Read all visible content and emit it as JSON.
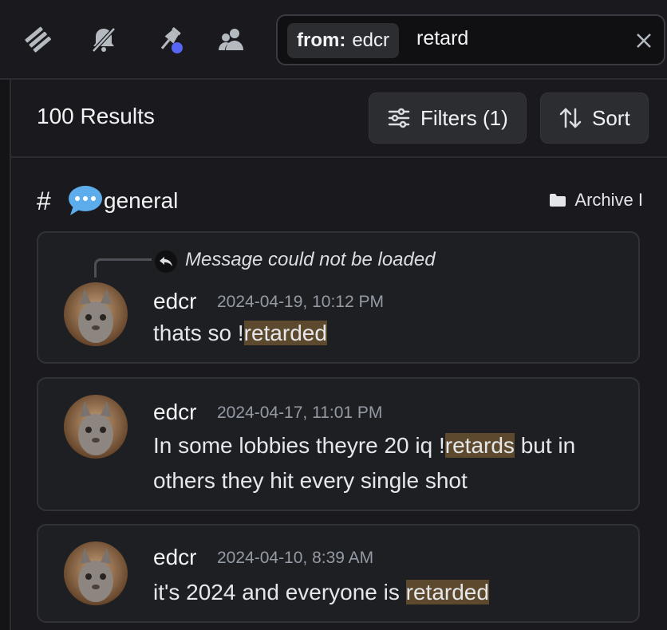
{
  "toolbar": {
    "icons": [
      "threads-icon",
      "mute-bell-icon",
      "pinned-icon",
      "members-icon"
    ]
  },
  "search": {
    "filter_key": "from:",
    "filter_value": "edcr",
    "query": "retard"
  },
  "results": {
    "count_label": "100 Results",
    "filters_label": "Filters (1)",
    "sort_label": "Sort"
  },
  "channel": {
    "hash": "#",
    "name": "general",
    "archive_label": "Archive I"
  },
  "messages": [
    {
      "reply_text": "Message could not be loaded",
      "author": "edcr",
      "timestamp": "2024-04-19, 10:12 PM",
      "text_before": "thats so !",
      "highlight": "retarded",
      "text_after": ""
    },
    {
      "author": "edcr",
      "timestamp": "2024-04-17, 11:01 PM",
      "text_before": "In some lobbies theyre 20 iq !",
      "highlight": "retards",
      "text_after": " but in others they hit every single shot"
    },
    {
      "author": "edcr",
      "timestamp": "2024-04-10, 8:39 AM",
      "text_before": "it's 2024 and everyone is ",
      "highlight": "retarded",
      "text_after": ""
    }
  ],
  "colors": {
    "background": "#1a1a1e",
    "card": "#1e1f23",
    "highlight": "#5d4a2e",
    "notification_dot": "#5865f2"
  }
}
